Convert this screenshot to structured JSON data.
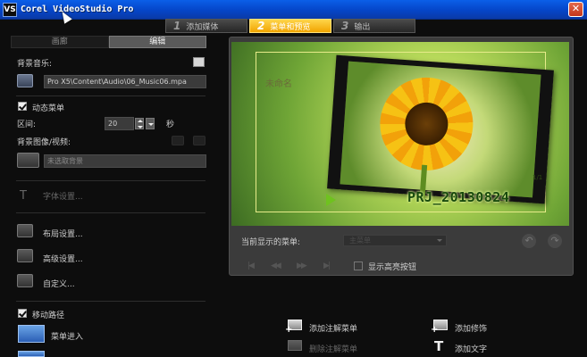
{
  "window": {
    "title": "Corel VideoStudio Pro",
    "icon_text": "VS",
    "close_glyph": "✕"
  },
  "steps": [
    {
      "num": "1",
      "label": "添加媒体",
      "active": false
    },
    {
      "num": "2",
      "label": "菜单和预览",
      "active": true
    },
    {
      "num": "3",
      "label": "输出",
      "active": false
    }
  ],
  "left": {
    "tabs": [
      {
        "label": "画廊"
      },
      {
        "label": "编辑"
      }
    ],
    "bg_music_label": "背景音乐:",
    "music_path": "Pro X5\\Content\\Audio\\06_Music06.mpa",
    "animated_menu_label": "动态菜单",
    "interval_label": "区间:",
    "interval_value": "20",
    "interval_unit": "秒",
    "bg_image_label": "背景图像/视频:",
    "bg_placeholder": "未选取背景",
    "font_settings": "字体设置...",
    "layout_settings": "布局设置...",
    "advanced_settings": "高级设置...",
    "customize": "自定义...",
    "motion_path_label": "移动路径",
    "menu_enter": "菜单进入"
  },
  "preview": {
    "menu_title": "未命名",
    "project_name": "PRJ_20130824",
    "page_indicator": "1/1",
    "current_menu_label": "当前显示的菜单:",
    "current_menu_value": "主菜单",
    "show_highlight_label": "显示高亮按钮"
  },
  "tools": {
    "add_chapter_menu": "添加注解菜单",
    "delete_chapter_menu": "删除注解菜单",
    "add_decoration": "添加修饰",
    "add_text": "添加文字"
  }
}
